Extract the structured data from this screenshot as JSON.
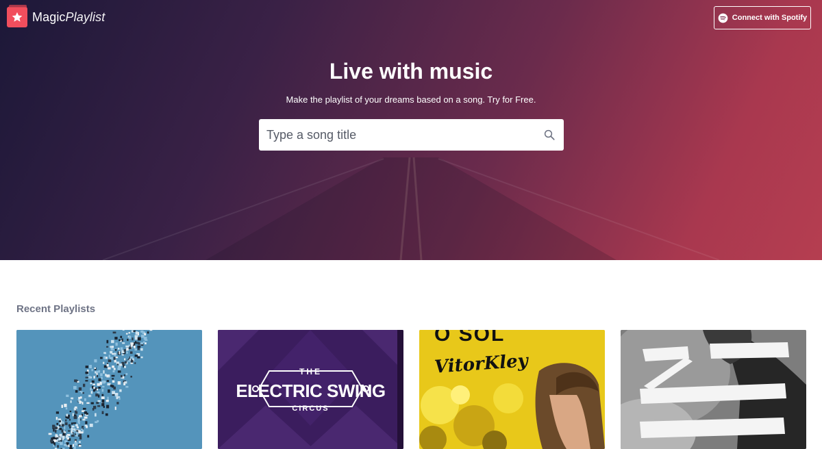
{
  "brand": {
    "name_part1": "Magic",
    "name_part2": "Playlist"
  },
  "header": {
    "connect_label": "Connect with Spotify"
  },
  "hero": {
    "title": "Live with music",
    "subtitle": "Make the playlist of your dreams based on a song. Try for Free.",
    "search_placeholder": "Type a song title"
  },
  "recent": {
    "title": "Recent Playlists",
    "cards": [
      {
        "art": "blue-dotted-swirl"
      },
      {
        "art": "electric-swing-circus",
        "line1": "THE",
        "line2": "ELECTRIC SWING",
        "line3": "CIRCUS"
      },
      {
        "art": "vitor-kley-o-sol",
        "line1": "O SOL",
        "line2": "VitorKley"
      },
      {
        "art": "zhu-stripes"
      }
    ]
  },
  "colors": {
    "hero_start": "#1c1838",
    "hero_end": "#b53e50",
    "brand_accent": "#f14e5d",
    "section_title": "#6e7385"
  }
}
